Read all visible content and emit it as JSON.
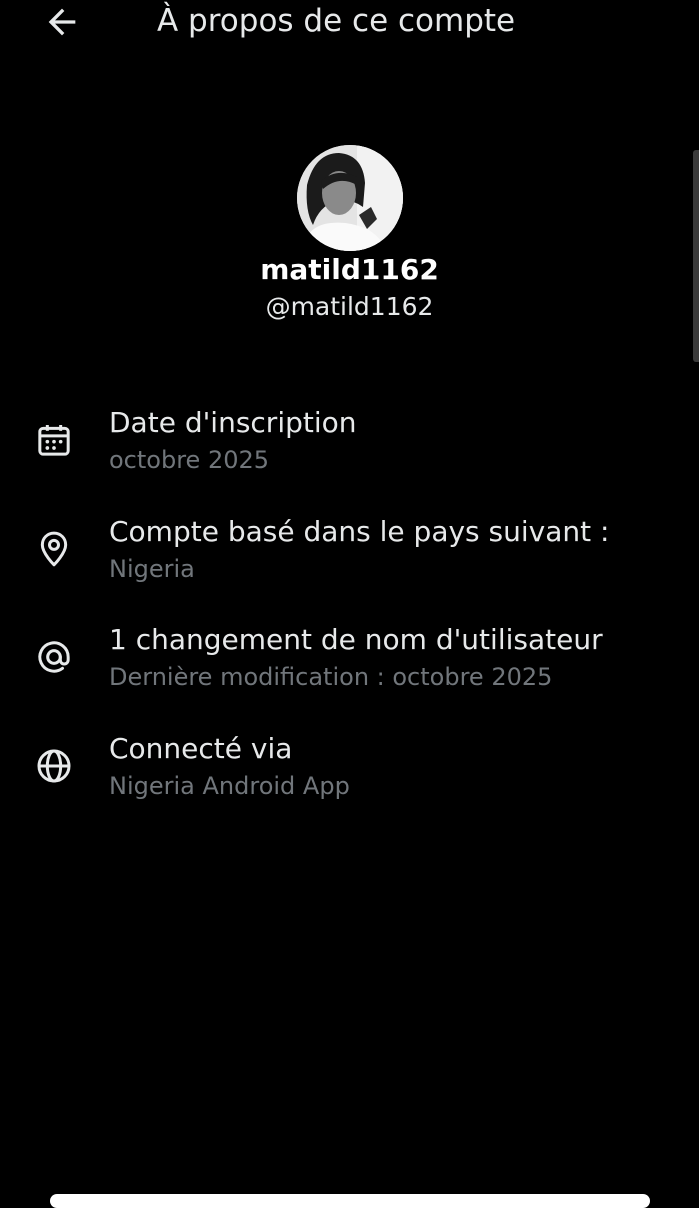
{
  "header": {
    "back_icon": "arrow-left-icon",
    "title": "À propos de ce compte"
  },
  "profile": {
    "name": "matild1162",
    "handle": "@matild1162"
  },
  "info": [
    {
      "icon": "calendar-icon",
      "title": "Date d'inscription",
      "subtitle": "octobre 2025"
    },
    {
      "icon": "location-pin-icon",
      "title": "Compte basé dans le pays suivant :",
      "subtitle": "Nigeria"
    },
    {
      "icon": "at-sign-icon",
      "title": "1 changement de nom d'utilisateur",
      "subtitle": "Dernière modification : octobre 2025"
    },
    {
      "icon": "globe-icon",
      "title": "Connecté via",
      "subtitle": "Nigeria Android App"
    }
  ],
  "colors": {
    "background": "#000000",
    "primary_text": "#e7e9ea",
    "secondary_text": "#71767b"
  }
}
